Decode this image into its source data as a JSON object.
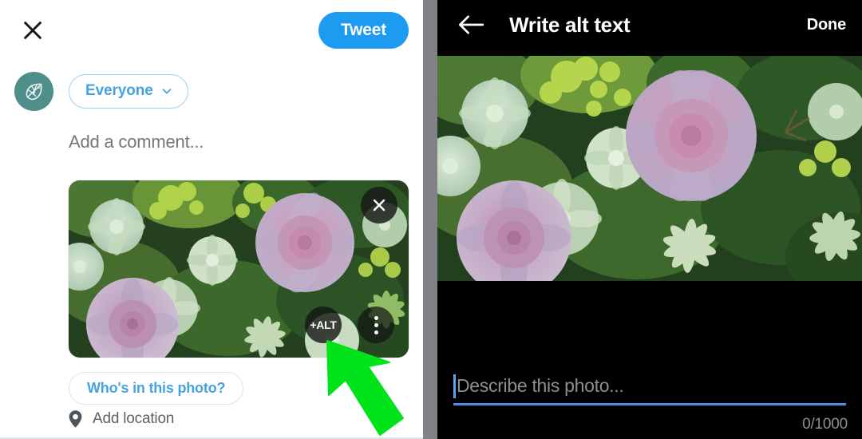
{
  "composer": {
    "close_icon": "close-x-icon",
    "tweet_button_label": "Tweet",
    "avatar_icon": "leaf-logo-avatar",
    "audience_label": "Everyone",
    "audience_chevron_icon": "chevron-down-icon",
    "comment_placeholder": "Add a comment...",
    "media": {
      "alt_badge_label": "+ALT",
      "remove_icon": "close-x-icon",
      "more_options_icon": "three-dots-vertical-icon",
      "photo_alt": "Succulent garden with pink and purple echeveria rosettes among green succulents"
    },
    "whos_in_photo_label": "Who's in this photo?",
    "add_location_label": "Add location",
    "location_icon": "map-pin-icon",
    "pointer_annotation_icon": "green-arrow-cursor"
  },
  "alt_editor": {
    "back_icon": "arrow-left-icon",
    "title": "Write alt text",
    "done_label": "Done",
    "photo_alt": "Succulent garden with pink and purple echeveria rosettes among green succulents",
    "describe_placeholder": "Describe this photo...",
    "char_counter": "0/1000"
  },
  "colors": {
    "twitter_blue": "#1D9BF0",
    "link_blue": "#46A3E0",
    "avatar_teal": "#4F8E8B",
    "pointer_green": "#00E000",
    "panel_black": "#000000",
    "divider_gray": "#808285",
    "underline_blue": "#4A90E2"
  }
}
